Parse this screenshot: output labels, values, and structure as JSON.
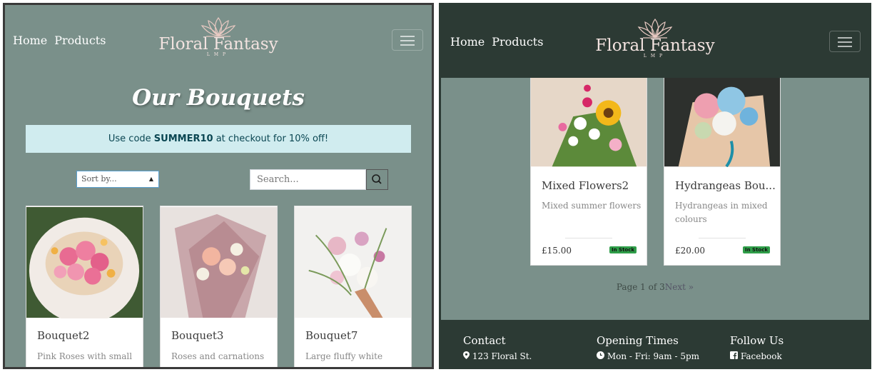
{
  "nav": {
    "home": "Home",
    "products": "Products",
    "brand_name": "Floral Fantasy",
    "brand_sub": "LMP"
  },
  "left": {
    "title": "Our Bouquets",
    "promo_before": "Use code ",
    "promo_code": "SUMMER10",
    "promo_after": " at checkout for 10% off!",
    "sort_label": "Sort by...",
    "search_placeholder": "Search...",
    "products": [
      {
        "name": "Bouquet2",
        "desc": "Pink Roses with small"
      },
      {
        "name": "Bouquet3",
        "desc": "Roses and carnations"
      },
      {
        "name": "Bouquet7",
        "desc": "Large fluffy white"
      }
    ]
  },
  "right": {
    "products": [
      {
        "name": "Mixed Flowers2",
        "desc": "Mixed summer flowers",
        "price": "£15.00",
        "stock": "In Stock"
      },
      {
        "name": "Hydrangeas Bou...",
        "desc": "Hydrangeas in mixed colours",
        "price": "£20.00",
        "stock": "In Stock"
      }
    ],
    "pager": {
      "text": "Page 1 of 3",
      "next": "Next »"
    },
    "footer": {
      "contact_head": "Contact",
      "contact_line": "123 Floral St.",
      "hours_head": "Opening Times",
      "hours_line": "Mon - Fri: 9am - 5pm",
      "follow_head": "Follow Us",
      "follow_line": "Facebook"
    }
  },
  "colors": {
    "page_bg": "#7a908a",
    "nav_dark": "#2c3a34",
    "promo_bg": "#d0ecef",
    "stock_badge": "#2f9e49"
  },
  "icons": [
    "lotus-logo-icon",
    "hamburger-menu-icon",
    "search-icon",
    "map-marker-icon",
    "clock-icon",
    "facebook-icon"
  ]
}
